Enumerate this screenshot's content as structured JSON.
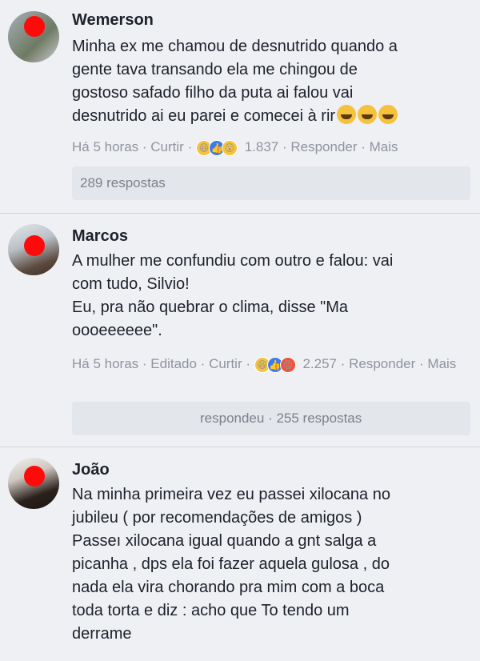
{
  "comments": [
    {
      "name": "Wemerson",
      "text": "Minha ex me chamou de desnutrido quando a\ngente tava transando ela me chingou de\ngostoso safado filho da puta ai falou vai\ndesnutrido ai eu parei e comecei à rir",
      "text_emojis": [
        "laughing-tears",
        "laughing-tears",
        "laughing-tears"
      ],
      "time": "Há 5 horas",
      "like": "Curtir",
      "reactions": [
        "haha",
        "like",
        "wow"
      ],
      "reaction_count": "1.837",
      "reply": "Responder",
      "more": "Mais",
      "replies_label": "289 respostas"
    },
    {
      "name": "Marcos",
      "text": "A mulher me confundiu com outro e falou: vai\ncom tudo, Silvio!\nEu, pra não quebrar o clima, disse \"Ma\noooeeeeee\".",
      "time": "Há 5 horas",
      "edited": "Editado",
      "like": "Curtir",
      "reactions": [
        "haha",
        "like",
        "angry"
      ],
      "reaction_count": "2.257",
      "reply": "Responder",
      "more": "Mais",
      "replies_label": "respondeu · 255 respostas"
    },
    {
      "name": "João",
      "text": "Na minha primeira vez eu passei xilocana no\njubileu ( por recomendações de amigos )\nPasseı xilocana igual quando a gnt salga a\npicanha , dps ela foi fazer aquela gulosa , do\nnada ela vira chorando pra mim com a boca\ntoda torta e diz : acho que To tendo um\nderrame"
    }
  ],
  "colors": {
    "background": "#eef0f4",
    "meta": "#90949c",
    "reply_box": "#e3e6eb"
  }
}
